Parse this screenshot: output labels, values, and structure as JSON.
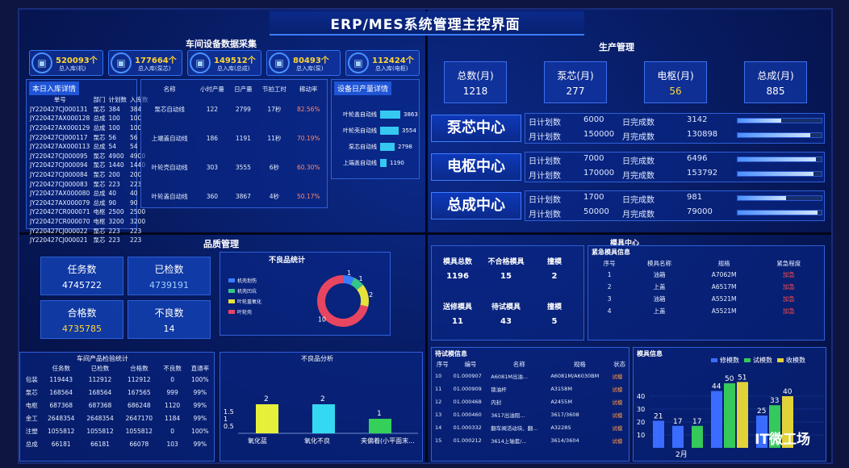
{
  "title": "ERP/MES系统管理主控界面",
  "sections": {
    "workshop": "车间设备数据采集",
    "production": "生产管理",
    "quality": "品质管理",
    "mold": "模具中心"
  },
  "kpis": [
    {
      "value": "520093个",
      "label": "总入库(机)",
      "color": "#ffd633"
    },
    {
      "value": "177664个",
      "label": "总入库(泵芯)",
      "color": "#ffd633"
    },
    {
      "value": "149512个",
      "label": "总入库(总成)",
      "color": "#ffd633"
    },
    {
      "value": "80493个",
      "label": "总入库(泵)",
      "color": "#ffd633"
    },
    {
      "value": "112424个",
      "label": "总入库(电枢)",
      "color": "#ffd633"
    }
  ],
  "inbound": {
    "title": "本日入库详情",
    "headers": [
      "单号",
      "部门",
      "计划数",
      "入库数"
    ],
    "rows": [
      [
        "JY220427CJ000131",
        "泵芯",
        "384",
        "384"
      ],
      [
        "JY220427AX000128",
        "总成",
        "100",
        "100"
      ],
      [
        "JY220427AX000129",
        "总成",
        "100",
        "100"
      ],
      [
        "JY220427CJ000117",
        "泵芯",
        "56",
        "56"
      ],
      [
        "JY220427AX000113",
        "总成",
        "54",
        "54"
      ],
      [
        "JY220427CJ000095",
        "泵芯",
        "4900",
        "4900"
      ],
      [
        "JY220427CJ000094",
        "泵芯",
        "1440",
        "1440"
      ],
      [
        "JY220427CJ000084",
        "泵芯",
        "200",
        "200"
      ],
      [
        "JY220427CJ000083",
        "泵芯",
        "223",
        "223"
      ],
      [
        "JY220427AX000080",
        "总成",
        "40",
        "40"
      ],
      [
        "JY220427AX000079",
        "总成",
        "90",
        "90"
      ],
      [
        "JY220427CR000071",
        "电枢",
        "2500",
        "2500"
      ],
      [
        "JY220427CR000070",
        "电枢",
        "3200",
        "3200"
      ],
      [
        "JY220427CJ000022",
        "泵芯",
        "223",
        "223"
      ],
      [
        "JY220427CJ000021",
        "泵芯",
        "223",
        "223"
      ]
    ]
  },
  "lines": {
    "headers": [
      "名称",
      "小时产量",
      "日产量",
      "节拍工时",
      "稼动率"
    ],
    "rows": [
      [
        "泵芯自动线",
        "122",
        "2799",
        "17秒",
        "82.56%"
      ],
      [
        "上端盖自动线",
        "186",
        "1191",
        "11秒",
        "70.19%"
      ],
      [
        "叶轮壳自动线",
        "303",
        "3555",
        "6秒",
        "60.30%"
      ],
      [
        "叶轮盖自动线",
        "360",
        "3867",
        "4秒",
        "50.17%"
      ]
    ]
  },
  "daily": {
    "title": "设备日产量详情",
    "items": [
      {
        "name": "叶轮盖自动线",
        "value": 3863
      },
      {
        "name": "叶轮壳自动线",
        "value": 3554
      },
      {
        "name": "泵芯自动线",
        "value": 2798
      },
      {
        "name": "上端盖自动线",
        "value": 1190
      }
    ],
    "max": 4000
  },
  "prod_boxes": [
    {
      "label": "总数(月)",
      "value": "1218",
      "color": "#ffffff"
    },
    {
      "label": "泵芯(月)",
      "value": "277",
      "color": "#ffffff"
    },
    {
      "label": "电枢(月)",
      "value": "56",
      "color": "#ffd633"
    },
    {
      "label": "总成(月)",
      "value": "885",
      "color": "#ffffff"
    }
  ],
  "centers": [
    {
      "name": "泵芯中心",
      "day_label": "日计划数",
      "day_plan": "6000",
      "day_done_label": "日完成数",
      "day_done": "3142",
      "month_label": "月计划数",
      "month_plan": "150000",
      "month_done_label": "月完成数",
      "month_done": "130898",
      "day_pct": 0.52,
      "month_pct": 0.87
    },
    {
      "name": "电枢中心",
      "day_label": "日计划数",
      "day_plan": "7000",
      "day_done_label": "日完成数",
      "day_done": "6496",
      "month_label": "月计划数",
      "month_plan": "170000",
      "month_done_label": "月完成数",
      "month_done": "153792",
      "day_pct": 0.93,
      "month_pct": 0.9
    },
    {
      "name": "总成中心",
      "day_label": "日计划数",
      "day_plan": "1700",
      "day_done_label": "日完成数",
      "day_done": "981",
      "month_label": "月计划数",
      "month_plan": "50000",
      "month_done_label": "月完成数",
      "month_done": "79000",
      "day_pct": 0.58,
      "month_pct": 0.95
    }
  ],
  "quality": {
    "task_label": "任务数",
    "task": "4745722",
    "checked_label": "已检数",
    "checked": "4739191",
    "pass_label": "合格数",
    "pass": "4735785",
    "bad_label": "不良数",
    "bad": "14"
  },
  "defect_stats": {
    "title": "不良品统计",
    "legend": [
      "机壳划伤",
      "机壳凹坑",
      "叶轮盖氧化",
      "叶轮壳"
    ],
    "values": [
      1,
      1,
      2,
      10
    ],
    "colors": [
      "#3a7cff",
      "#35c48a",
      "#e7e23a",
      "#e84560"
    ]
  },
  "inspect": {
    "title": "车间产品检验统计",
    "headers": [
      "",
      "任务数",
      "已检数",
      "合格数",
      "不良数",
      "直通率"
    ],
    "rows": [
      [
        "包装",
        "119443",
        "112912",
        "112912",
        "0",
        "100%"
      ],
      [
        "泵芯",
        "168564",
        "168564",
        "167565",
        "999",
        "99%"
      ],
      [
        "电枢",
        "687368",
        "687368",
        "686248",
        "1120",
        "99%"
      ],
      [
        "金工",
        "2648354",
        "2648354",
        "2647170",
        "1184",
        "99%"
      ],
      [
        "注塑",
        "1055812",
        "1055812",
        "1055812",
        "0",
        "100%"
      ],
      [
        "总成",
        "66181",
        "66181",
        "66078",
        "103",
        "99%"
      ]
    ]
  },
  "defect_analysis": {
    "title": "不良品分析",
    "categories": [
      "氧化蓝",
      "氧化不良",
      "夹偏着(小平面末..."
    ],
    "values": [
      2,
      2,
      1
    ],
    "colors": [
      "#e6f03a",
      "#34d8f0",
      "#35d05a"
    ],
    "yticks": [
      "1.5",
      "1",
      "0.5"
    ]
  },
  "mold_stats": [
    {
      "label": "模具总数",
      "value": "1196"
    },
    {
      "label": "不合格模具",
      "value": "15"
    },
    {
      "label": "撞模",
      "value": "2"
    },
    {
      "label": "送修模具",
      "value": "11"
    },
    {
      "label": "待试模具",
      "value": "43"
    },
    {
      "label": "撞模",
      "value": "5"
    }
  ],
  "urgent": {
    "title": "紧急模具信息",
    "headers": [
      "序号",
      "模具名称",
      "规格",
      "紧急程度"
    ],
    "rows": [
      [
        "1",
        "油箱",
        "A7062M",
        "加急"
      ],
      [
        "2",
        "上盖",
        "A6517M",
        "加急"
      ],
      [
        "3",
        "油箱",
        "A5521M",
        "加急"
      ],
      [
        "4",
        "上盖",
        "A5521M",
        "加急"
      ]
    ]
  },
  "trial": {
    "title": "待试模信息",
    "headers": [
      "序号",
      "编号",
      "名称",
      "规格",
      "状态"
    ],
    "rows": [
      [
        "10",
        "01.000907",
        "A6081M出油...",
        "A6081M/A6030BM",
        "试模"
      ],
      [
        "11",
        "01.000909",
        "锁油杆",
        "A3158M",
        "试模"
      ],
      [
        "12",
        "01.000468",
        "内封",
        "A2455M",
        "试模"
      ],
      [
        "13",
        "01.000460",
        "3617出油阻...",
        "3617/3608",
        "试模"
      ],
      [
        "14",
        "01.000332",
        "翻车阀活动块、翻...",
        "A3228S",
        "试模"
      ],
      [
        "15",
        "01.000212",
        "3614上轴套/...",
        "3614/3604",
        "试模"
      ]
    ]
  },
  "mold_info": {
    "title": "模具信息",
    "legend": [
      "修模数",
      "试模数",
      "收模数"
    ],
    "colors": [
      "#3a6cff",
      "#35c85a",
      "#e2d23a"
    ],
    "xlabel": "2月",
    "yticks": [
      "10",
      "20",
      "30",
      "40"
    ],
    "groups": [
      [
        21,
        0,
        0
      ],
      [
        17,
        0,
        0
      ],
      [
        0,
        17,
        0
      ],
      [
        44,
        50,
        51
      ],
      [
        25,
        33,
        40
      ]
    ]
  },
  "watermark": "IT微工场"
}
